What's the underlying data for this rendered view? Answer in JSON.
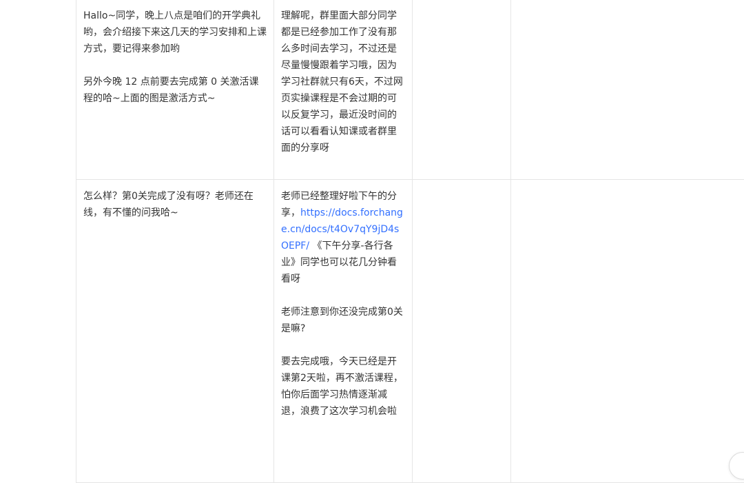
{
  "rows": [
    {
      "col1": [
        "Hallo~同学，晚上八点是咱们的开学典礼哟，会介绍接下来这几天的学习安排和上课方式，要记得来参加哟",
        "另外今晚 12 点前要去完成第 0 关激活课程的哈~上面的图是激活方式~"
      ],
      "col2": [
        "理解呢，群里面大部分同学都是已经参加工作了没有那么多时间去学习，不过还是尽量慢慢跟着学习哦，因为学习社群就只有6天，不过网页实操课程是不会过期的可以反复学习，最近没时间的话可以看看认知课或者群里面的分享呀"
      ]
    },
    {
      "col1": [
        "怎么样？第0关完成了没有呀？老师还在线，有不懂的问我哈~"
      ],
      "col2_intro": "老师已经整理好啦下午的分享，",
      "col2_link": "https://docs.forchange.cn/docs/t4Ov7qY9jD4sOEPF/",
      "col2_after_link": " 《下午分享-各行各业》同学也可以花几分钟看看呀",
      "col2_rest": [
        "老师注意到你还没完成第0关是嘛?",
        "要去完成哦，今天已经是开课第2天啦，再不激活课程，怕你后面学习热情逐渐减退，浪费了这次学习机会啦"
      ]
    }
  ]
}
